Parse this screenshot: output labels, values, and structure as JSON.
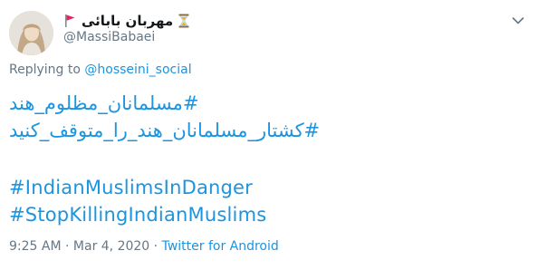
{
  "user": {
    "display_name": "مهربان بابائی",
    "handle": "@MassiBabaei"
  },
  "reply": {
    "prefix": "Replying to",
    "mention": "@hosseini_social"
  },
  "tweet": {
    "line1": "#مسلمانان_مظلوم_هند",
    "line2": "#کشتار_مسلمانان_هند_را_متوقف_کنید",
    "line3": "#IndianMuslimsInDanger",
    "line4": "#StopKillingIndianMuslims"
  },
  "meta": {
    "time": "9:25 AM",
    "sep1": "·",
    "date": "Mar 4, 2020",
    "sep2": "·",
    "app": "Twitter for Android"
  },
  "colors": {
    "link": "#1b95e0",
    "muted": "#657786",
    "text": "#14171a",
    "flag": "#e0245e",
    "hourglass": "#f4b400"
  },
  "icons": {
    "flag": "triangular-flag-icon",
    "hourglass": "hourglass-icon",
    "caret": "chevron-down-icon"
  }
}
